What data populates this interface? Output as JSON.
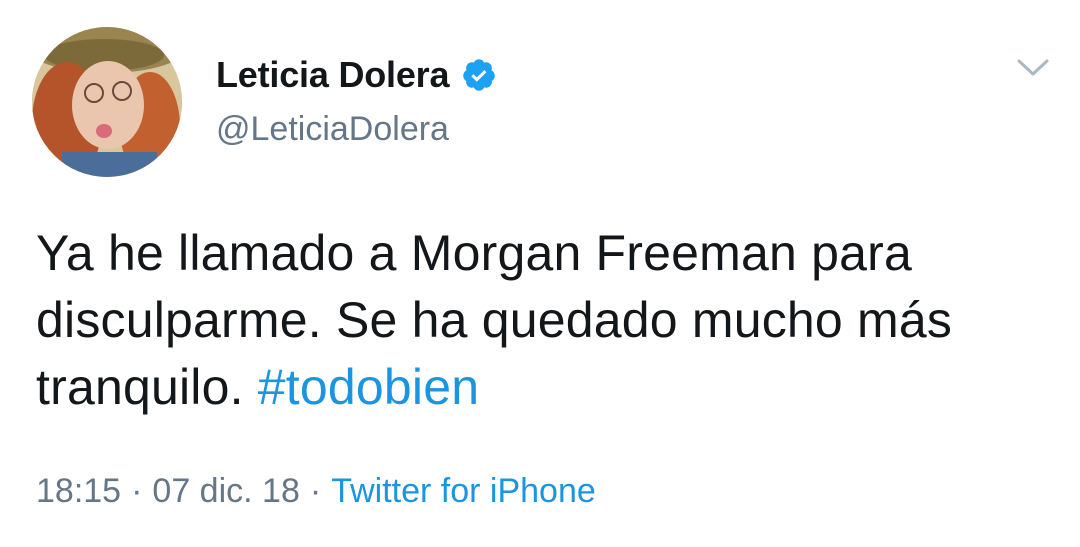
{
  "user": {
    "display_name": "Leticia Dolera",
    "handle": "@LeticiaDolera",
    "verified_icon": "verified-badge-icon"
  },
  "tweet": {
    "text": "Ya he llamado a Morgan Freeman para disculparme. Se ha quedado mucho más tranquilo.",
    "hashtag": "#todobien",
    "time": "18:15",
    "date": "07 dic. 18",
    "separator": "·",
    "source": "Twitter for iPhone"
  },
  "menu": {
    "icon": "chevron-down-icon"
  },
  "colors": {
    "text": "#14171a",
    "secondary": "#657786",
    "link": "#1b95e0",
    "verified": "#1da1f2"
  }
}
